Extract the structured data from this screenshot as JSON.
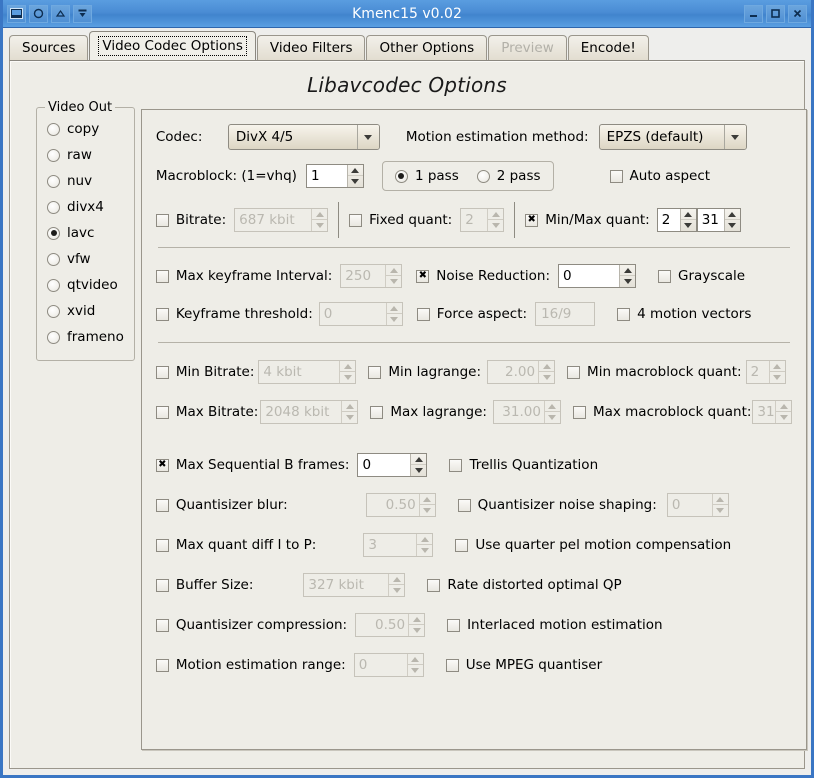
{
  "window": {
    "title": "Kmenc15 v0.02",
    "titlebar_left_icons": [
      "window-menu-icon",
      "sticky-icon",
      "shade-icon",
      "unshade-icon"
    ],
    "titlebar_right_icons": [
      "minimize-icon",
      "maximize-icon",
      "close-icon"
    ],
    "accent_color": "#4a8cd4",
    "bg_color": "#eeede7"
  },
  "tabs": [
    {
      "label": "Sources",
      "state": "normal"
    },
    {
      "label": "Video Codec Options",
      "state": "active"
    },
    {
      "label": "Video Filters",
      "state": "normal"
    },
    {
      "label": "Other Options",
      "state": "normal"
    },
    {
      "label": "Preview",
      "state": "disabled"
    },
    {
      "label": "Encode!",
      "state": "normal"
    }
  ],
  "page": {
    "title": "Libavcodec Options"
  },
  "video_out": {
    "group_title": "Video Out",
    "options": [
      {
        "label": "copy",
        "selected": false
      },
      {
        "label": "raw",
        "selected": false
      },
      {
        "label": "nuv",
        "selected": false
      },
      {
        "label": "divx4",
        "selected": false
      },
      {
        "label": "lavc",
        "selected": true
      },
      {
        "label": "vfw",
        "selected": false
      },
      {
        "label": "qtvideo",
        "selected": false
      },
      {
        "label": "xvid",
        "selected": false
      },
      {
        "label": "frameno",
        "selected": false
      }
    ]
  },
  "codec": {
    "label": "Codec:",
    "value": "DivX 4/5"
  },
  "motion_estimation": {
    "label": "Motion estimation method:",
    "value": "EPZS (default)"
  },
  "macroblock": {
    "label": "Macroblock: (1=vhq)",
    "value": "1",
    "enabled": true
  },
  "pass": {
    "options": [
      {
        "label": "1 pass",
        "selected": true
      },
      {
        "label": "2 pass",
        "selected": false
      }
    ]
  },
  "auto_aspect": {
    "label": "Auto aspect",
    "checked": false
  },
  "bitrate": {
    "label": "Bitrate:",
    "checked": false,
    "value": "687 kbit",
    "enabled": false
  },
  "fixed_quant": {
    "label": "Fixed quant:",
    "checked": false,
    "value": "2",
    "enabled": false
  },
  "minmax_quant": {
    "label": "Min/Max quant:",
    "checked": true,
    "min_value": "2",
    "max_value": "31",
    "enabled": true
  },
  "max_keyframe_interval": {
    "label": "Max keyframe Interval:",
    "checked": false,
    "value": "250",
    "enabled": false
  },
  "noise_reduction": {
    "label": "Noise Reduction:",
    "checked": true,
    "value": "0",
    "enabled": true
  },
  "grayscale": {
    "label": "Grayscale",
    "checked": false
  },
  "keyframe_threshold": {
    "label": "Keyframe threshold:",
    "checked": false,
    "value": "0",
    "enabled": false
  },
  "force_aspect": {
    "label": "Force aspect:",
    "checked": false,
    "value": "16/9",
    "enabled": false
  },
  "four_motion_vectors": {
    "label": "4 motion vectors",
    "checked": false
  },
  "min_bitrate": {
    "label": "Min Bitrate:",
    "checked": false,
    "value": "4 kbit",
    "enabled": false
  },
  "min_lagrange": {
    "label": "Min lagrange:",
    "checked": false,
    "value": "2.00",
    "enabled": false
  },
  "min_macroblock_quant": {
    "label": "Min macroblock quant:",
    "checked": false,
    "value": "2",
    "enabled": false
  },
  "max_bitrate": {
    "label": "Max Bitrate:",
    "checked": false,
    "value": "2048 kbit",
    "enabled": false
  },
  "max_lagrange": {
    "label": "Max lagrange:",
    "checked": false,
    "value": "31.00",
    "enabled": false
  },
  "max_macroblock_quant": {
    "label": "Max macroblock quant:",
    "checked": false,
    "value": "31",
    "enabled": false
  },
  "max_seq_b_frames": {
    "label": "Max Sequential B frames:",
    "checked": true,
    "value": "0",
    "enabled": true
  },
  "trellis_quantization": {
    "label": "Trellis Quantization",
    "checked": false
  },
  "quantisizer_blur": {
    "label": "Quantisizer blur:",
    "checked": false,
    "value": "0.50",
    "enabled": false
  },
  "quantisizer_noise_shaping": {
    "label": "Quantisizer noise shaping:",
    "checked": false,
    "value": "0",
    "enabled": false
  },
  "max_quant_diff": {
    "label": "Max quant diff I to P:",
    "checked": false,
    "value": "3",
    "enabled": false
  },
  "quarter_pel": {
    "label": "Use quarter pel motion compensation",
    "checked": false
  },
  "buffer_size": {
    "label": "Buffer Size:",
    "checked": false,
    "value": "327 kbit",
    "enabled": false
  },
  "rate_distorted_qp": {
    "label": "Rate distorted optimal QP",
    "checked": false
  },
  "quantisizer_compression": {
    "label": "Quantisizer compression:",
    "checked": false,
    "value": "0.50",
    "enabled": false
  },
  "interlaced_motion_estimation": {
    "label": "Interlaced motion estimation",
    "checked": false
  },
  "motion_estimation_range": {
    "label": "Motion estimation range:",
    "checked": false,
    "value": "0",
    "enabled": false
  },
  "use_mpeg_quantiser": {
    "label": "Use MPEG quantiser",
    "checked": false
  }
}
